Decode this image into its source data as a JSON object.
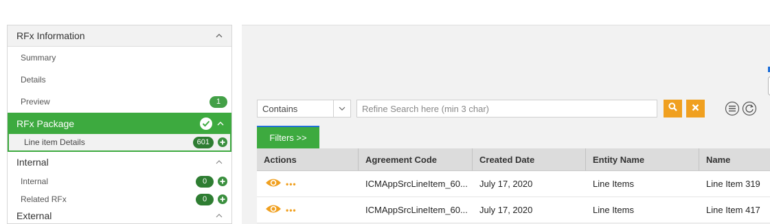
{
  "sidebar": {
    "rfx_information": {
      "title": "RFx Information",
      "items": [
        {
          "label": "Summary"
        },
        {
          "label": "Details"
        },
        {
          "label": "Preview",
          "count": "1"
        }
      ]
    },
    "rfx_package": {
      "title": "RFx Package",
      "items": [
        {
          "label": "Line item Details",
          "count": "601"
        }
      ]
    },
    "internal": {
      "title": "Internal",
      "items": [
        {
          "label": "Internal",
          "count": "0"
        },
        {
          "label": "Related RFx",
          "count": "0"
        }
      ]
    },
    "external": {
      "title": "External"
    }
  },
  "toolbar": {
    "filter_operator": "Contains",
    "search_placeholder": "Refine Search here (min 3 char)",
    "filters_label": "Filters >>"
  },
  "grid": {
    "columns": [
      "Actions",
      "Agreement Code",
      "Created Date",
      "Entity Name",
      "Name"
    ],
    "rows": [
      {
        "agreement_code": "ICMAppSrcLineItem_60...",
        "created_date": "July 17, 2020",
        "entity_name": "Line Items",
        "name": "Line Item 319"
      },
      {
        "agreement_code": "ICMAppSrcLineItem_60...",
        "created_date": "July 17, 2020",
        "entity_name": "Line Items",
        "name": "Line Item 417"
      }
    ]
  },
  "colors": {
    "accent_green": "#3daa3f",
    "action_orange": "#f0a020",
    "focus_blue": "#1e6fd9"
  },
  "icons": [
    "chevron-up-icon",
    "check-circle-icon",
    "plus-circle-icon",
    "chevron-down-icon",
    "search-icon",
    "clear-icon",
    "list-view-icon",
    "refresh-icon",
    "eye-icon",
    "more-icon"
  ]
}
